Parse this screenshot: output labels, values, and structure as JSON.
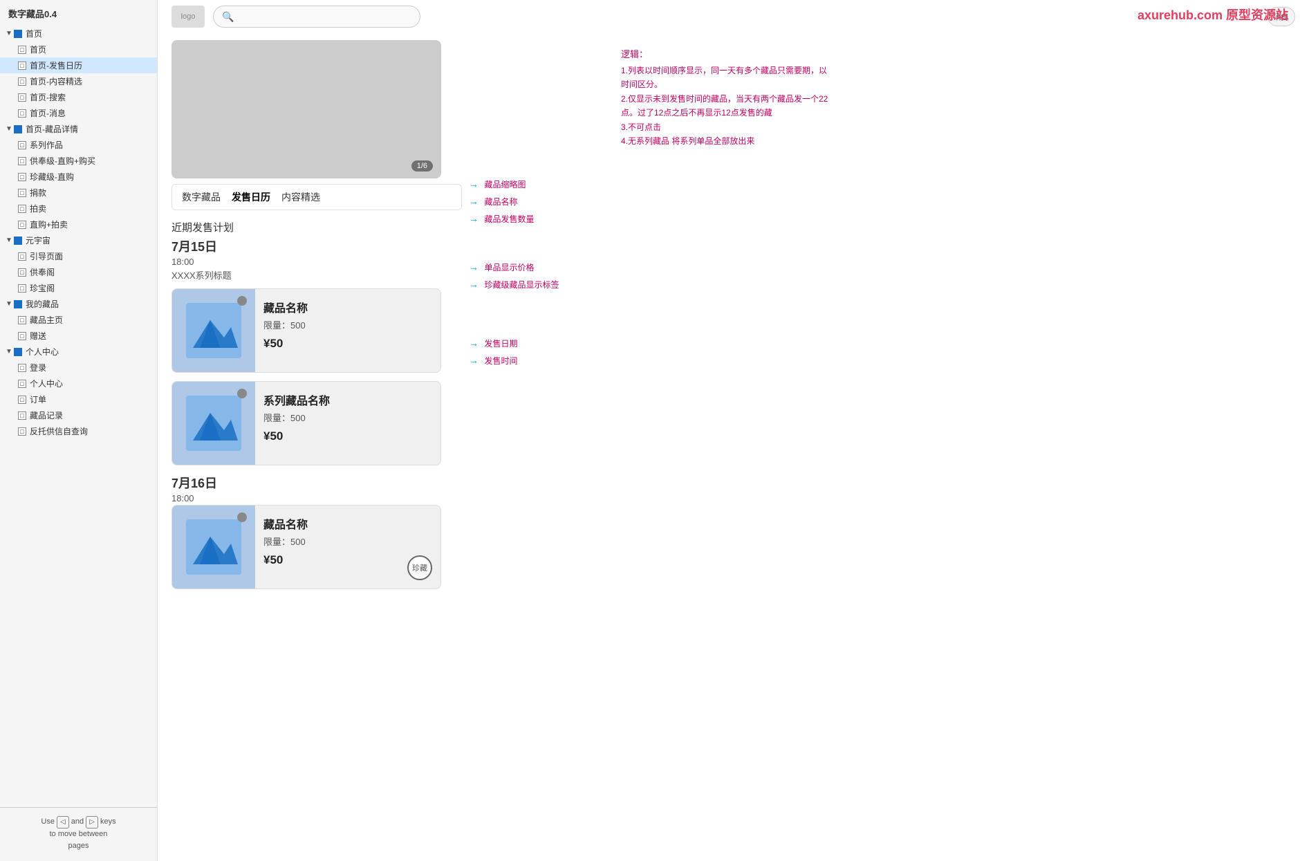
{
  "sidebar": {
    "title": "数字藏品0.4",
    "items": [
      {
        "label": "首页",
        "level": 1,
        "type": "group",
        "expanded": true
      },
      {
        "label": "首页",
        "level": 2,
        "type": "page"
      },
      {
        "label": "首页-发售日历",
        "level": 2,
        "type": "page",
        "selected": true
      },
      {
        "label": "首页-内容精选",
        "level": 2,
        "type": "page"
      },
      {
        "label": "首页-搜索",
        "level": 2,
        "type": "page"
      },
      {
        "label": "首页-消息",
        "level": 2,
        "type": "page"
      },
      {
        "label": "首页-藏品详情",
        "level": 1,
        "type": "group",
        "expanded": true
      },
      {
        "label": "系列作品",
        "level": 2,
        "type": "page"
      },
      {
        "label": "供奉级-直购+购买",
        "level": 2,
        "type": "page"
      },
      {
        "label": "珍藏级-直购",
        "level": 2,
        "type": "page"
      },
      {
        "label": "捐款",
        "level": 2,
        "type": "page"
      },
      {
        "label": "拍卖",
        "level": 2,
        "type": "page"
      },
      {
        "label": "直购+拍卖",
        "level": 2,
        "type": "page"
      },
      {
        "label": "元宇宙",
        "level": 1,
        "type": "group",
        "expanded": true
      },
      {
        "label": "引导页面",
        "level": 2,
        "type": "page"
      },
      {
        "label": "供奉阁",
        "level": 2,
        "type": "page"
      },
      {
        "label": "珍宝阁",
        "level": 2,
        "type": "page"
      },
      {
        "label": "我的藏品",
        "level": 1,
        "type": "group",
        "expanded": true
      },
      {
        "label": "藏品主页",
        "level": 2,
        "type": "page"
      },
      {
        "label": "赠送",
        "level": 2,
        "type": "page"
      },
      {
        "label": "个人中心",
        "level": 1,
        "type": "group",
        "expanded": true
      },
      {
        "label": "登录",
        "level": 2,
        "type": "page"
      },
      {
        "label": "个人中心",
        "level": 2,
        "type": "page"
      },
      {
        "label": "订单",
        "level": 2,
        "type": "page"
      },
      {
        "label": "藏品记录",
        "level": 2,
        "type": "page"
      },
      {
        "label": "反托供信自查询",
        "level": 2,
        "type": "page"
      }
    ]
  },
  "footer": {
    "line1": "Use",
    "key1": "◁",
    "line2": "and",
    "key2": "▷",
    "line3": "keys",
    "line4": "to move between",
    "line5": "pages"
  },
  "topbar": {
    "logo": "logo",
    "search_placeholder": "搜索",
    "message_btn": "消息",
    "watermark": "axurehub.com 原型资源站"
  },
  "banner": {
    "indicator": "1/6"
  },
  "tabs": [
    {
      "label": "数字藏品",
      "active": false
    },
    {
      "label": "发售日历",
      "active": true
    },
    {
      "label": "内容精选",
      "active": false
    }
  ],
  "sale_plan": {
    "section_title": "近期发售计划",
    "date1": "7月15日",
    "time1": "18:00",
    "series1": "XXXX系列标题",
    "date2": "7月16日",
    "time2": "18:00"
  },
  "products": [
    {
      "name": "藏品名称",
      "limit": "限量：500",
      "price": "¥50",
      "badge": "",
      "is_series": false
    },
    {
      "name": "系列藏品名称",
      "limit": "限量：500",
      "price": "¥50",
      "badge": "",
      "is_series": true
    },
    {
      "name": "藏品名称",
      "limit": "限量：500",
      "price": "¥50",
      "badge": "珍藏",
      "is_series": false
    }
  ],
  "annotations": {
    "thumb": "藏品缩略图",
    "name": "藏品名称",
    "quantity": "藏品发售数量",
    "price": "单品显示价格",
    "badge": "珍藏级藏品显示标签",
    "date": "发售日期",
    "time": "发售时间"
  },
  "logic": {
    "title": "逻辑：",
    "items": [
      "1.列表以时间顺序显示，同一天有多个藏品只需要期，以时间区分。",
      "2.仅显示未到发售时间的藏品，当天有两个藏品发一个22点。过了12点之后不再显示12点发售的藏",
      "3.不可点击",
      "4.无系列藏品 将系列单品全部放出来"
    ]
  }
}
